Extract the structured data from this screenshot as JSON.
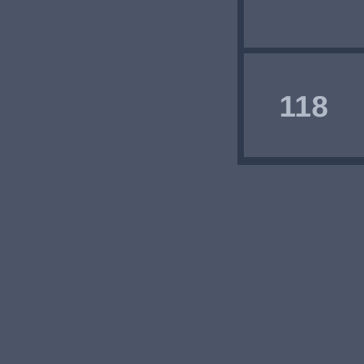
{
  "grid": {
    "cells": [
      {
        "value": ""
      },
      {
        "value": "118"
      }
    ]
  },
  "colors": {
    "background": "#4b5567",
    "grid_line": "#2f3a4e",
    "cell_text": "#b2bac8"
  }
}
